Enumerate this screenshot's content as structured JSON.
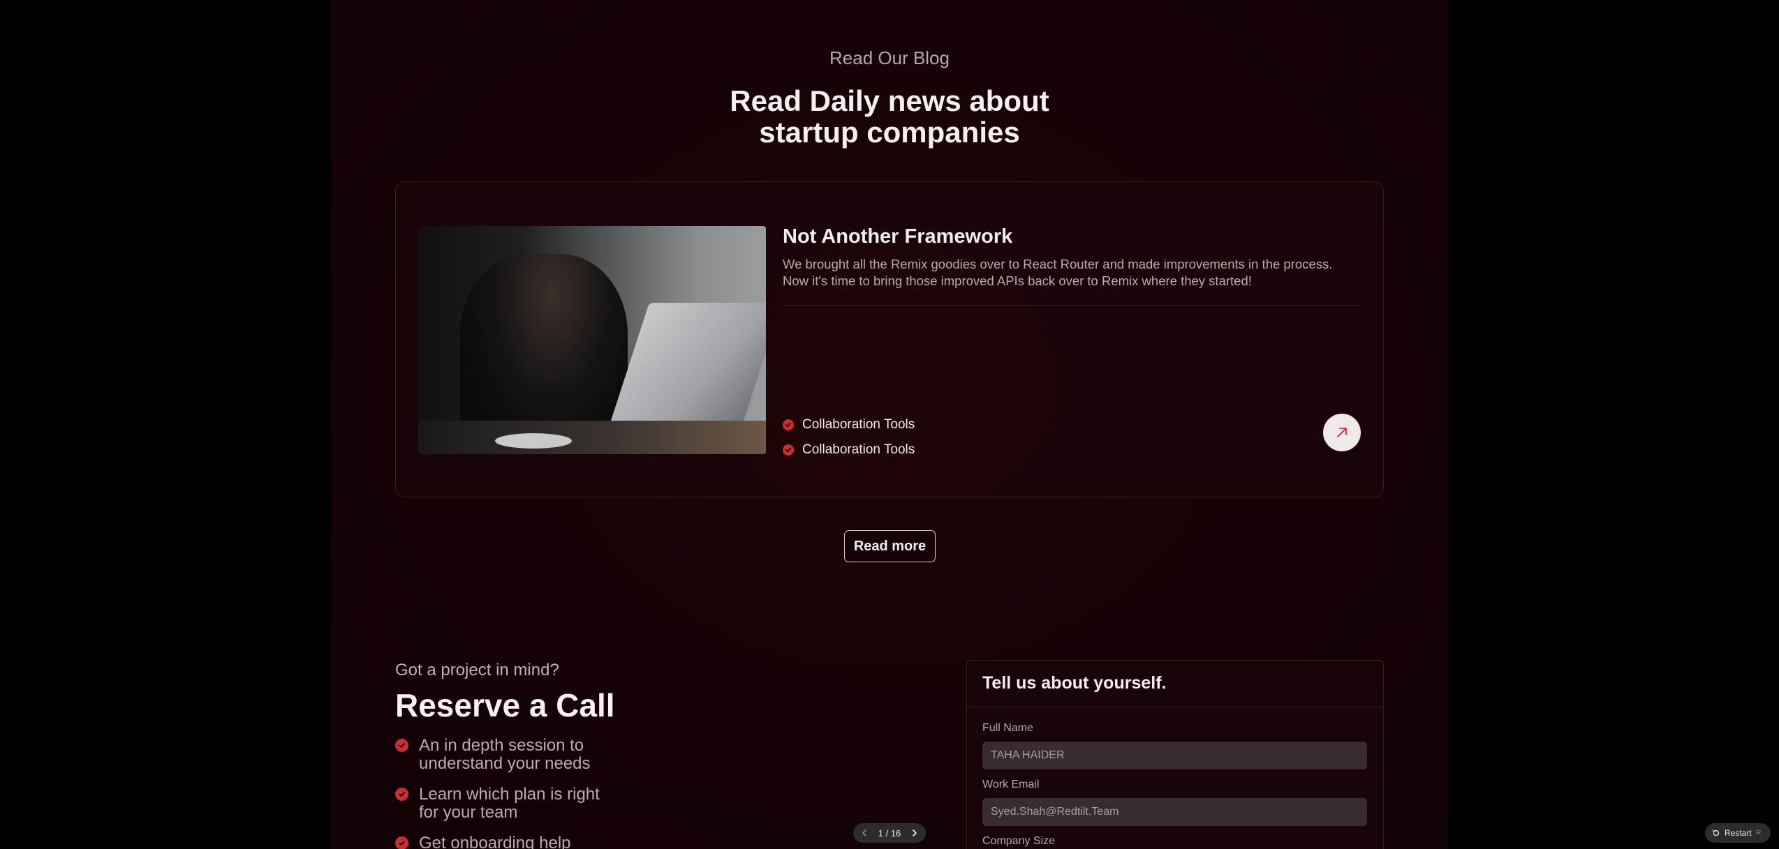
{
  "blog": {
    "eyebrow": "Read Our Blog",
    "headline_line1": "Read Daily news about",
    "headline_line2": "startup companies",
    "card": {
      "title": "Not Another Framework",
      "desc_line1": "We brought all the Remix goodies over to React Router and made improvements in the process.",
      "desc_line2": "Now it's time to bring those improved APIs back over to Remix where they started!",
      "features": [
        "Collaboration Tools",
        "Collaboration Tools"
      ]
    },
    "read_more": "Read more"
  },
  "cta": {
    "eyebrow": "Got a project in mind?",
    "title": "Reserve a Call",
    "items": [
      "An in depth session to understand your needs",
      "Learn which plan is right for your team",
      "Get onboarding help"
    ]
  },
  "form": {
    "title": "Tell us about yourself.",
    "full_name_label": "Full Name",
    "full_name_value": "TAHA HAIDER",
    "work_email_label": "Work Email",
    "work_email_value": "Syed.Shah@Redtilt.Team",
    "company_size_label": "Company Size"
  },
  "pager": {
    "text": "1 / 16"
  },
  "restart": {
    "label": "Restart",
    "shortcut": "R"
  },
  "colors": {
    "accent": "#c92e34",
    "background": "#160305"
  }
}
